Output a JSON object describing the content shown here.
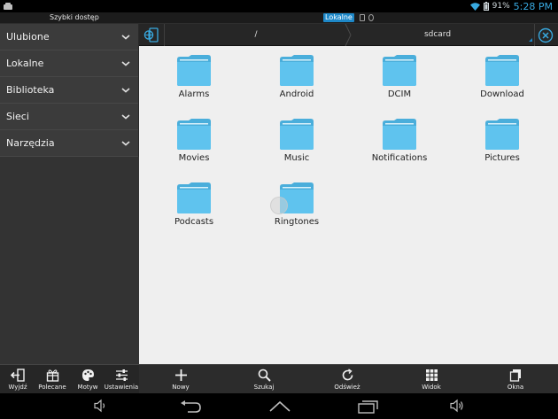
{
  "status": {
    "battery_pct": "91%",
    "time": "5:28 PM"
  },
  "app": {
    "title": "Szybki dostęp",
    "location_badge": "Lokalne"
  },
  "sidebar": {
    "items": [
      {
        "label": "Ulubione"
      },
      {
        "label": "Lokalne"
      },
      {
        "label": "Biblioteka"
      },
      {
        "label": "Sieci"
      },
      {
        "label": "Narzędzia"
      }
    ]
  },
  "path": {
    "crumbs": [
      "/",
      "sdcard"
    ]
  },
  "folders": [
    {
      "name": "Alarms"
    },
    {
      "name": "Android"
    },
    {
      "name": "DCIM"
    },
    {
      "name": "Download"
    },
    {
      "name": "Movies"
    },
    {
      "name": "Music"
    },
    {
      "name": "Notifications"
    },
    {
      "name": "Pictures"
    },
    {
      "name": "Podcasts"
    },
    {
      "name": "Ringtones"
    }
  ],
  "toolbar": {
    "left": [
      {
        "label": "Wyjdź",
        "icon": "exit-icon"
      },
      {
        "label": "Polecane",
        "icon": "gift-icon"
      },
      {
        "label": "Motyw",
        "icon": "theme-icon"
      },
      {
        "label": "Ustawienia",
        "icon": "settings-sliders-icon"
      }
    ],
    "right": [
      {
        "label": "Nowy",
        "icon": "plus-icon"
      },
      {
        "label": "Szukaj",
        "icon": "search-icon"
      },
      {
        "label": "Odśwież",
        "icon": "refresh-icon"
      },
      {
        "label": "Widok",
        "icon": "grid-icon"
      },
      {
        "label": "Okna",
        "icon": "windows-icon"
      }
    ]
  },
  "colors": {
    "folder_blue": "#5bc0eb",
    "accent": "#1e88c8"
  }
}
